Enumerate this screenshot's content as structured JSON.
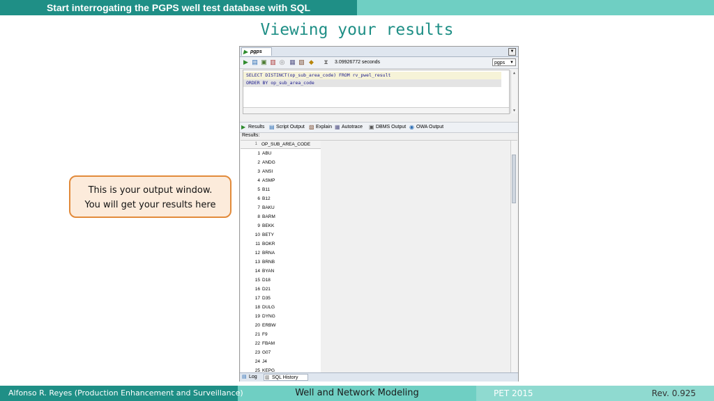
{
  "header": {
    "banner_title": "Start interrogating the PGPS well test database with SQL",
    "slide_title": "Viewing your results"
  },
  "ide": {
    "worksheet_tab": "pgps",
    "toolbar": {
      "buttons": [
        "run-statement-icon",
        "run-script-icon",
        "commit-icon",
        "rollback-icon",
        "cancel-icon",
        "autotrace-icon",
        "explain-plan-icon",
        "clear-icon"
      ],
      "elapsed_time": "3.09926772 seconds",
      "connection": "pgps"
    },
    "editor": {
      "lines": [
        "SELECT DISTINCT(op_sub_area_code) FROM rv_pwel_result",
        "ORDER BY op_sub_area_code"
      ]
    },
    "output_tabs": [
      "Results",
      "Script Output",
      "Explain",
      "Autotrace",
      "DBMS Output",
      "OWA Output"
    ],
    "results_label": "Results:",
    "grid": {
      "column": "OP_SUB_AREA_CODE",
      "rows": [
        {
          "n": "1",
          "v": "ABU"
        },
        {
          "n": "2",
          "v": "ANDG"
        },
        {
          "n": "3",
          "v": "ANSI"
        },
        {
          "n": "4",
          "v": "ASMP"
        },
        {
          "n": "5",
          "v": "B11"
        },
        {
          "n": "6",
          "v": "B12"
        },
        {
          "n": "7",
          "v": "BAKU"
        },
        {
          "n": "8",
          "v": "BARM"
        },
        {
          "n": "9",
          "v": "BEKK"
        },
        {
          "n": "10",
          "v": "BETY"
        },
        {
          "n": "11",
          "v": "BOKR"
        },
        {
          "n": "12",
          "v": "BRNA"
        },
        {
          "n": "13",
          "v": "BRNB"
        },
        {
          "n": "14",
          "v": "BYAN"
        },
        {
          "n": "15",
          "v": "D18"
        },
        {
          "n": "16",
          "v": "D21"
        },
        {
          "n": "17",
          "v": "D35"
        },
        {
          "n": "18",
          "v": "DULG"
        },
        {
          "n": "19",
          "v": "DYNG"
        },
        {
          "n": "20",
          "v": "ERBW"
        },
        {
          "n": "21",
          "v": "F9"
        },
        {
          "n": "22",
          "v": "FBAM"
        },
        {
          "n": "23",
          "v": "G07"
        },
        {
          "n": "24",
          "v": "J4"
        },
        {
          "n": "25",
          "v": "KEPG"
        }
      ]
    },
    "bottom_tabs": [
      "Log",
      "SQL History"
    ]
  },
  "callout": {
    "line1": "This is your output window.",
    "line2": "You will get your results here"
  },
  "footer": {
    "author": "Alfonso R. Reyes (Production Enhancement and Surveillance)",
    "course": "Well and Network Modeling",
    "event": "PET 2015",
    "revision": "Rev. 0.925"
  },
  "colors": {
    "dark_teal": "#1f8f86",
    "light_teal": "#6fcfc3",
    "callout_fill": "#fcebdb",
    "callout_border": "#e28a3a",
    "title_text": "#1f8f86"
  }
}
